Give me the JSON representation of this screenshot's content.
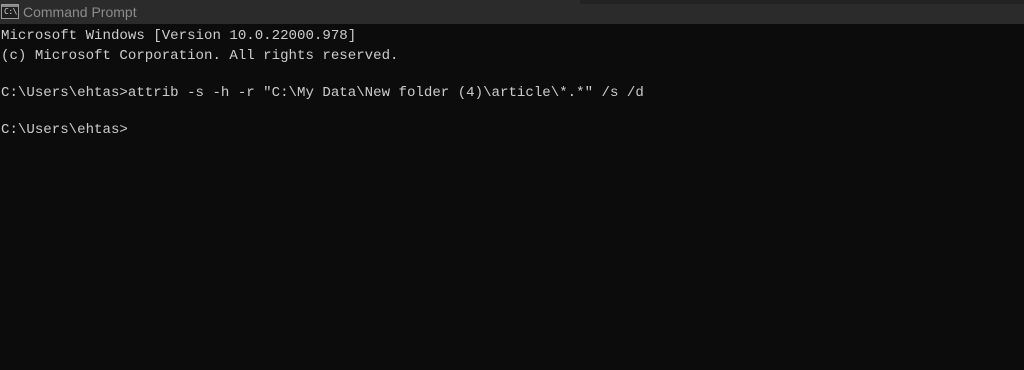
{
  "window": {
    "title": "Command Prompt",
    "icon": "cmd-icon",
    "icon_glyph": "C:\\",
    "colors": {
      "titlebar": "#2b2b2b",
      "background": "#0c0c0c",
      "text": "#cccccc",
      "title_text": "#8c8c8c"
    }
  },
  "console": {
    "lines": [
      "Microsoft Windows [Version 10.0.22000.978]",
      "(c) Microsoft Corporation. All rights reserved.",
      "",
      "C:\\Users\\ehtas>attrib -s -h -r \"C:\\My Data\\New folder (4)\\article\\*.*\" /s /d",
      "",
      "C:\\Users\\ehtas>"
    ]
  }
}
